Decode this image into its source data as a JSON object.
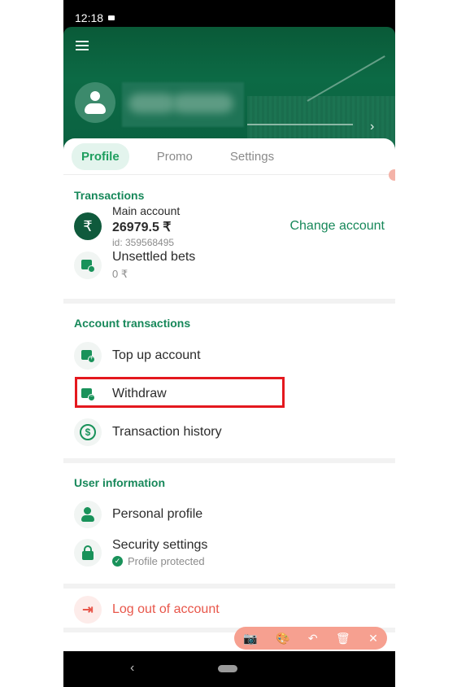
{
  "status_bar": {
    "time": "12:18"
  },
  "header": {
    "menu_icon": "hamburger-icon",
    "avatar_icon": "user-avatar-icon",
    "profile_arrow": "›"
  },
  "tabs": [
    {
      "label": "Profile",
      "active": true
    },
    {
      "label": "Promo",
      "active": false
    },
    {
      "label": "Settings",
      "active": false
    }
  ],
  "transactions": {
    "title": "Transactions",
    "main_account": {
      "label": "Main account",
      "balance": "26979.5 ₹",
      "id": "id: 359568495",
      "icon": "₹"
    },
    "change_account": "Change account",
    "unsettled": {
      "label": "Unsettled bets",
      "value": "0 ₹"
    }
  },
  "account_transactions": {
    "title": "Account transactions",
    "items": [
      {
        "label": "Top up account",
        "icon": "wallet-plus-icon"
      },
      {
        "label": "Withdraw",
        "icon": "wallet-minus-icon",
        "highlighted": true
      },
      {
        "label": "Transaction history",
        "icon": "history-icon"
      }
    ]
  },
  "user_information": {
    "title": "User information",
    "personal_profile": "Personal profile",
    "security_settings": "Security settings",
    "security_status": "Profile protected"
  },
  "logout": "Log out of account",
  "overlay_toolbar": {
    "camera": "📷",
    "palette": "🎨",
    "undo": "↶",
    "delete": "🗑",
    "close": "✕"
  },
  "nav": {
    "back": "‹"
  },
  "colors": {
    "brand_green": "#17885a",
    "header_green": "#0c6a45",
    "logout_red": "#e8564a",
    "highlight_red": "#e4181e"
  }
}
